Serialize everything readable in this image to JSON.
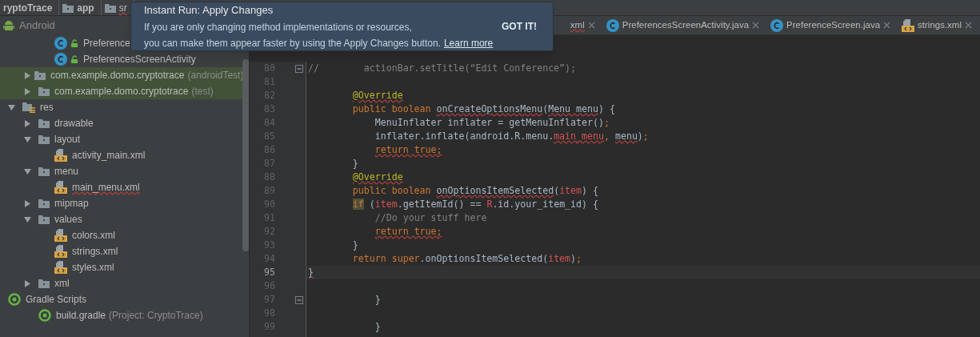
{
  "breadcrumb": [
    {
      "label": "ryptoTrace",
      "kind": "project"
    },
    {
      "label": "app",
      "kind": "module"
    },
    {
      "label": "sr",
      "kind": "folder"
    }
  ],
  "project_view": {
    "title": "Android"
  },
  "tree": [
    {
      "children": [
        {
          "children": [
            {
              "label": "Preference",
              "kind": "class",
              "test_scope": false,
              "error": false
            },
            {
              "label": "PreferencesScreenActivity",
              "kind": "class",
              "test_scope": false,
              "error": false
            }
          ]
        },
        {
          "label": "com.example.domo.cryptotrace",
          "suffix": "(androidTest)",
          "kind": "folder",
          "expanded": false,
          "test_scope": true,
          "error": false
        },
        {
          "label": "com.example.domo.cryptotrace",
          "suffix": "(test)",
          "kind": "folder",
          "expanded": false,
          "test_scope": true,
          "error": false
        }
      ]
    },
    {
      "label": "res",
      "kind": "res",
      "expanded": true,
      "test_scope": false,
      "error": false,
      "children": [
        {
          "label": "drawable",
          "kind": "folder",
          "expanded": false,
          "test_scope": false,
          "error": false
        },
        {
          "label": "layout",
          "kind": "folder",
          "expanded": true,
          "test_scope": false,
          "error": false,
          "children": [
            {
              "label": "activity_main.xml",
              "kind": "xml",
              "test_scope": false,
              "error": false
            }
          ]
        },
        {
          "label": "menu",
          "kind": "folder",
          "expanded": true,
          "test_scope": false,
          "error": false,
          "children": [
            {
              "label": "main_menu.xml",
              "kind": "xml",
              "test_scope": false,
              "error": true
            }
          ]
        },
        {
          "label": "mipmap",
          "kind": "folder",
          "expanded": false,
          "test_scope": false,
          "error": false
        },
        {
          "label": "values",
          "kind": "folder",
          "expanded": true,
          "test_scope": false,
          "error": false,
          "children": [
            {
              "label": "colors.xml",
              "kind": "xml",
              "test_scope": false,
              "error": false
            },
            {
              "label": "strings.xml",
              "kind": "xml",
              "test_scope": false,
              "error": false
            },
            {
              "label": "styles.xml",
              "kind": "xml",
              "test_scope": false,
              "error": false
            }
          ]
        },
        {
          "label": "xml",
          "kind": "folder",
          "expanded": false,
          "test_scope": false,
          "error": false
        }
      ]
    },
    {
      "label": "Gradle Scripts",
      "kind": "gradle-root",
      "test_scope": false,
      "error": false,
      "children": [
        {
          "label": "build.gradle",
          "suffix": "(Project: CryptoTrace)",
          "kind": "gradle",
          "test_scope": false,
          "error": false
        }
      ]
    }
  ],
  "editor_tabs": [
    {
      "label": "xml",
      "error": true
    },
    {
      "label": "PreferencesScreenActivity.java",
      "kind": "class",
      "error": false
    },
    {
      "label": "PreferenceScreen.java",
      "kind": "class",
      "error": false
    },
    {
      "label": "strings.xml",
      "kind": "xml",
      "error": false
    }
  ],
  "code_lines": [
    {
      "number": "80",
      "fold": true,
      "current": false,
      "tokens": [
        {
          "text": "//        actionBar.setTitle(“Edit Conference”);",
          "kind": "comment",
          "squiggle": false
        }
      ]
    },
    {
      "number": "81",
      "fold": false,
      "current": false
    },
    {
      "number": "82",
      "fold": false,
      "current": false,
      "tokens": [
        {
          "text": "        @Override",
          "kind": "annotation",
          "squiggle": true
        }
      ]
    },
    {
      "number": "83",
      "fold": false,
      "current": false,
      "tokens": [
        {
          "text": "        public boolean ",
          "kind": "keyword",
          "squiggle": false
        },
        {
          "text": "onCreateOptionsMenu",
          "kind": "plain",
          "squiggle": true
        },
        {
          "text": "(",
          "kind": "plain",
          "squiggle": false
        },
        {
          "text": "Menu menu",
          "kind": "plain",
          "squiggle": true
        },
        {
          "text": ") {",
          "kind": "plain",
          "squiggle": false
        }
      ]
    },
    {
      "number": "84",
      "fold": false,
      "current": false,
      "tokens": [
        {
          "text": "            MenuInflater inflater = getMenuInflater()",
          "kind": "plain",
          "squiggle": false
        },
        {
          "text": ";",
          "kind": "keyword",
          "squiggle": false
        }
      ]
    },
    {
      "number": "85",
      "fold": false,
      "current": false,
      "tokens": [
        {
          "text": "            inflater.inflate(android.R.menu.",
          "kind": "plain",
          "squiggle": false
        },
        {
          "text": "main_menu",
          "kind": "error",
          "squiggle": true
        },
        {
          "text": ", ",
          "kind": "keyword",
          "squiggle": false
        },
        {
          "text": "menu",
          "kind": "plain",
          "squiggle": true
        },
        {
          "text": ")",
          "kind": "plain",
          "squiggle": false
        },
        {
          "text": ";",
          "kind": "keyword",
          "squiggle": false
        }
      ]
    },
    {
      "number": "86",
      "fold": false,
      "current": false,
      "tokens": [
        {
          "text": "            return true;",
          "kind": "keyword",
          "squiggle": true
        }
      ]
    },
    {
      "number": "87",
      "fold": false,
      "current": false,
      "tokens": [
        {
          "text": "        }",
          "kind": "plain",
          "squiggle": false
        }
      ]
    },
    {
      "number": "88",
      "fold": false,
      "current": false,
      "tokens": [
        {
          "text": "        @Override",
          "kind": "annotation",
          "squiggle": true
        }
      ]
    },
    {
      "number": "89",
      "fold": false,
      "current": false,
      "tokens": [
        {
          "text": "        public boolean ",
          "kind": "keyword",
          "squiggle": false
        },
        {
          "text": "onOptionsItemSelected",
          "kind": "plain",
          "squiggle": true
        },
        {
          "text": "(",
          "kind": "plain",
          "squiggle": false
        },
        {
          "text": "item",
          "kind": "error",
          "squiggle": false
        },
        {
          "text": ") {",
          "kind": "plain",
          "squiggle": false
        }
      ]
    },
    {
      "number": "90",
      "fold": false,
      "current": false,
      "tokens": [
        {
          "text": "        if",
          "kind": "match",
          "squiggle": false
        },
        {
          "text": " (",
          "kind": "plain",
          "squiggle": false
        },
        {
          "text": "item",
          "kind": "error",
          "squiggle": false
        },
        {
          "text": ".getItemId() == ",
          "kind": "plain",
          "squiggle": false
        },
        {
          "text": "R",
          "kind": "error",
          "squiggle": false
        },
        {
          "text": ".id.your_item_id) {",
          "kind": "plain",
          "squiggle": false
        }
      ]
    },
    {
      "number": "91",
      "fold": false,
      "current": false,
      "tokens": [
        {
          "text": "            //Do your stuff here",
          "kind": "comment",
          "squiggle": false
        }
      ]
    },
    {
      "number": "92",
      "fold": false,
      "current": false,
      "tokens": [
        {
          "text": "            return true;",
          "kind": "keyword",
          "squiggle": true
        }
      ]
    },
    {
      "number": "93",
      "fold": false,
      "current": false,
      "tokens": [
        {
          "text": "        }",
          "kind": "plain",
          "squiggle": false
        }
      ]
    },
    {
      "number": "94",
      "fold": false,
      "current": false,
      "tokens": [
        {
          "text": "        return super",
          "kind": "keyword",
          "squiggle": false
        },
        {
          "text": ".onOptionsItemSelected(",
          "kind": "plain",
          "squiggle": false
        },
        {
          "text": "item",
          "kind": "error",
          "squiggle": false
        },
        {
          "text": ")",
          "kind": "plain",
          "squiggle": false
        },
        {
          "text": ";",
          "kind": "keyword",
          "squiggle": false
        }
      ]
    },
    {
      "number": "95",
      "fold": false,
      "current": true,
      "tokens": [
        {
          "text": "}",
          "kind": "plain",
          "squiggle": true
        }
      ]
    },
    {
      "number": "96",
      "fold": false,
      "current": false
    },
    {
      "number": "97",
      "fold": true,
      "current": false,
      "tokens": [
        {
          "text": "            }",
          "kind": "plain",
          "squiggle": false
        }
      ]
    },
    {
      "number": "98",
      "fold": false,
      "current": false
    },
    {
      "number": "99",
      "fold": false,
      "current": false,
      "tokens": [
        {
          "text": "            }",
          "kind": "plain",
          "squiggle": false
        }
      ]
    }
  ],
  "notification": {
    "title": "Instant Run: Apply Changes",
    "lines": [
      "If you are only changing method implementations or resources,",
      "you can make them appear faster by using the Apply Changes button."
    ],
    "link": "Learn more",
    "button": "GOT IT!"
  }
}
